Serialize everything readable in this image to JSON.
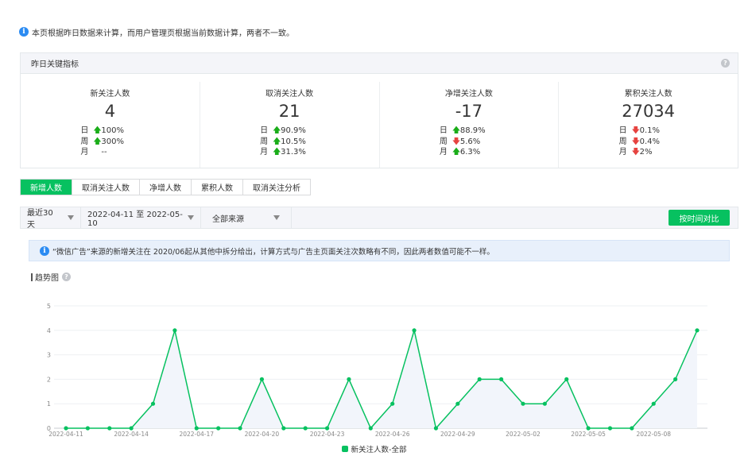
{
  "notice": "本页根据昨日数据来计算，而用户管理页根据当前数据计算，两者不一致。",
  "kpi": {
    "header": "昨日关键指标",
    "row_labels": [
      "日",
      "周",
      "月"
    ],
    "items": [
      {
        "title": "新关注人数",
        "value": "4",
        "rows": [
          {
            "dir": "up",
            "pct": "100%"
          },
          {
            "dir": "up",
            "pct": "300%"
          },
          {
            "dir": "none",
            "pct": "--"
          }
        ]
      },
      {
        "title": "取消关注人数",
        "value": "21",
        "rows": [
          {
            "dir": "up",
            "pct": "90.9%"
          },
          {
            "dir": "up",
            "pct": "10.5%"
          },
          {
            "dir": "up",
            "pct": "31.3%"
          }
        ]
      },
      {
        "title": "净增关注人数",
        "value": "-17",
        "rows": [
          {
            "dir": "up",
            "pct": "88.9%"
          },
          {
            "dir": "down",
            "pct": "5.6%"
          },
          {
            "dir": "up",
            "pct": "6.3%"
          }
        ]
      },
      {
        "title": "累积关注人数",
        "value": "27034",
        "rows": [
          {
            "dir": "down",
            "pct": "0.1%"
          },
          {
            "dir": "down",
            "pct": "0.4%"
          },
          {
            "dir": "down",
            "pct": "2%"
          }
        ]
      }
    ]
  },
  "tabs": [
    "新增人数",
    "取消关注人数",
    "净增人数",
    "累积人数",
    "取消关注分析"
  ],
  "filters": {
    "period": "最近30天",
    "date_range": "2022-04-11 至 2022-05-10",
    "source": "全部来源",
    "compare_button": "按时间对比"
  },
  "tip": "“微信广告”来源的新增关注在 2020/06起从其他中拆分给出，计算方式与广告主页面关注次数略有不同，因此两者数值可能不一样。",
  "trend_label": "趋势图",
  "colors": {
    "accent": "#07c160",
    "up": "#1aad19",
    "down": "#e64340",
    "info": "#2b8bf2"
  },
  "chart_data": {
    "type": "area",
    "y_ticks": [
      "0",
      "1",
      "2",
      "3",
      "4",
      "5"
    ],
    "ylim": [
      0,
      5
    ],
    "x_ticks": [
      "2022-04-11",
      "2022-04-14",
      "2022-04-17",
      "2022-04-20",
      "2022-04-23",
      "2022-04-26",
      "2022-04-29",
      "2022-05-02",
      "2022-05-05",
      "2022-05-08"
    ],
    "x": [
      "2022-04-11",
      "2022-04-12",
      "2022-04-13",
      "2022-04-14",
      "2022-04-15",
      "2022-04-16",
      "2022-04-17",
      "2022-04-18",
      "2022-04-19",
      "2022-04-20",
      "2022-04-21",
      "2022-04-22",
      "2022-04-23",
      "2022-04-24",
      "2022-04-25",
      "2022-04-26",
      "2022-04-27",
      "2022-04-28",
      "2022-04-29",
      "2022-04-30",
      "2022-05-01",
      "2022-05-02",
      "2022-05-03",
      "2022-05-04",
      "2022-05-05",
      "2022-05-06",
      "2022-05-07",
      "2022-05-08",
      "2022-05-09",
      "2022-05-10"
    ],
    "series": [
      {
        "name": "新关注人数-全部",
        "values": [
          0,
          0,
          0,
          0,
          1,
          4,
          0,
          0,
          0,
          2,
          0,
          0,
          0,
          2,
          0,
          1,
          4,
          0,
          1,
          2,
          2,
          1,
          1,
          2,
          0,
          0,
          0,
          1,
          2,
          4
        ]
      }
    ],
    "legend": "bottom-center"
  }
}
